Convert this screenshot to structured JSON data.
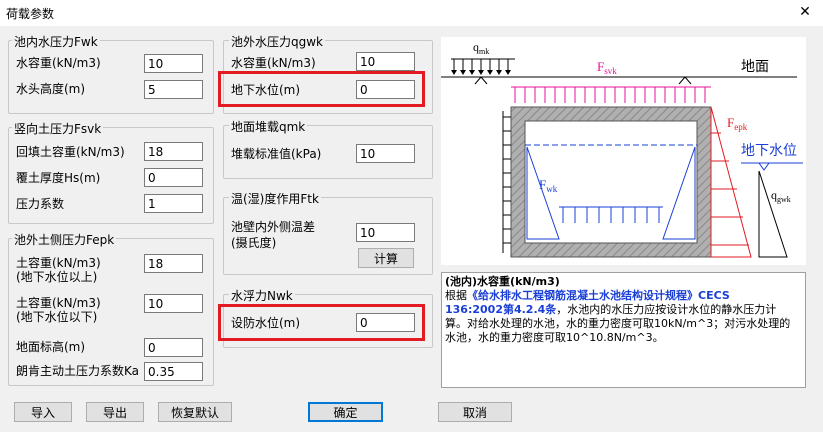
{
  "window": {
    "title": "荷载参数",
    "close_glyph": "✕"
  },
  "groups": {
    "fwk": {
      "title": "池内水压力Fwk",
      "fields": [
        {
          "label": "水容重(kN/m3)",
          "value": "10"
        },
        {
          "label": "水头高度(m)",
          "value": "5"
        }
      ]
    },
    "fsvk": {
      "title": "竖向土压力Fsvk",
      "fields": [
        {
          "label": "回填土容重(kN/m3)",
          "value": "18"
        },
        {
          "label": "覆土厚度Hs(m)",
          "value": "0"
        },
        {
          "label": "压力系数",
          "value": "1"
        }
      ]
    },
    "fepk": {
      "title": "池外土侧压力Fepk",
      "fields": [
        {
          "label": "土容重(kN/m3)",
          "label2": "(地下水位以上)",
          "value": "18"
        },
        {
          "label": "土容重(kN/m3)",
          "label2": "(地下水位以下)",
          "value": "10"
        },
        {
          "label": "地面标高(m)",
          "value": "0"
        },
        {
          "label": "朗肯主动土压力系数Ka",
          "value": "0.35"
        }
      ]
    },
    "qgwk": {
      "title": "池外水压力qgwk",
      "fields": [
        {
          "label": "水容重(kN/m3)",
          "value": "10"
        },
        {
          "label": "地下水位(m)",
          "value": "0"
        }
      ]
    },
    "qmk": {
      "title": "地面堆载qmk",
      "fields": [
        {
          "label": "堆载标准值(kPa)",
          "value": "10"
        }
      ]
    },
    "ftk": {
      "title": "温(湿)度作用Ftk",
      "fields": [
        {
          "label": "池壁内外侧温差",
          "label2": "(摄氏度)",
          "value": "10"
        }
      ],
      "calc_button": "计算"
    },
    "nwk": {
      "title": "水浮力Nwk",
      "fields": [
        {
          "label": "设防水位(m)",
          "value": "0"
        }
      ]
    }
  },
  "diagram": {
    "qmk_label": "q",
    "qmk_sub": "mk",
    "fsvk_label": "F",
    "fsvk_sub": "svk",
    "ground_label": "地面",
    "fepk_label": "F",
    "fepk_sub": "epk",
    "gw_label": "地下水位",
    "fwk_label": "F",
    "fwk_sub": "wk",
    "qgwk_label": "q",
    "qgwk_sub": "gwk",
    "colors": {
      "soil": "#e8129a",
      "ep": "#e21b23",
      "water": "#1a3fd6",
      "wall": "#8c8c8c"
    }
  },
  "description": {
    "title": "(池内)水容重(kN/m3)",
    "line1_prefix": "根据",
    "line1_link": "《给水排水工程钢筋混凝土水池结构设计规程》CECS",
    "line2_link": "136:2002第4.2.4条",
    "line2_rest": "，水池内的水压力应按设计水位的静水压力计",
    "line3": "算。对给水处理的水池，水的重力密度可取10kN/m^3；对污水处理的",
    "line4": "水池，水的重力密度可取10^10.8N/m^3。"
  },
  "buttons": {
    "import": "导入",
    "export": "导出",
    "restore": "恢复默认",
    "ok": "确定",
    "cancel": "取消"
  }
}
